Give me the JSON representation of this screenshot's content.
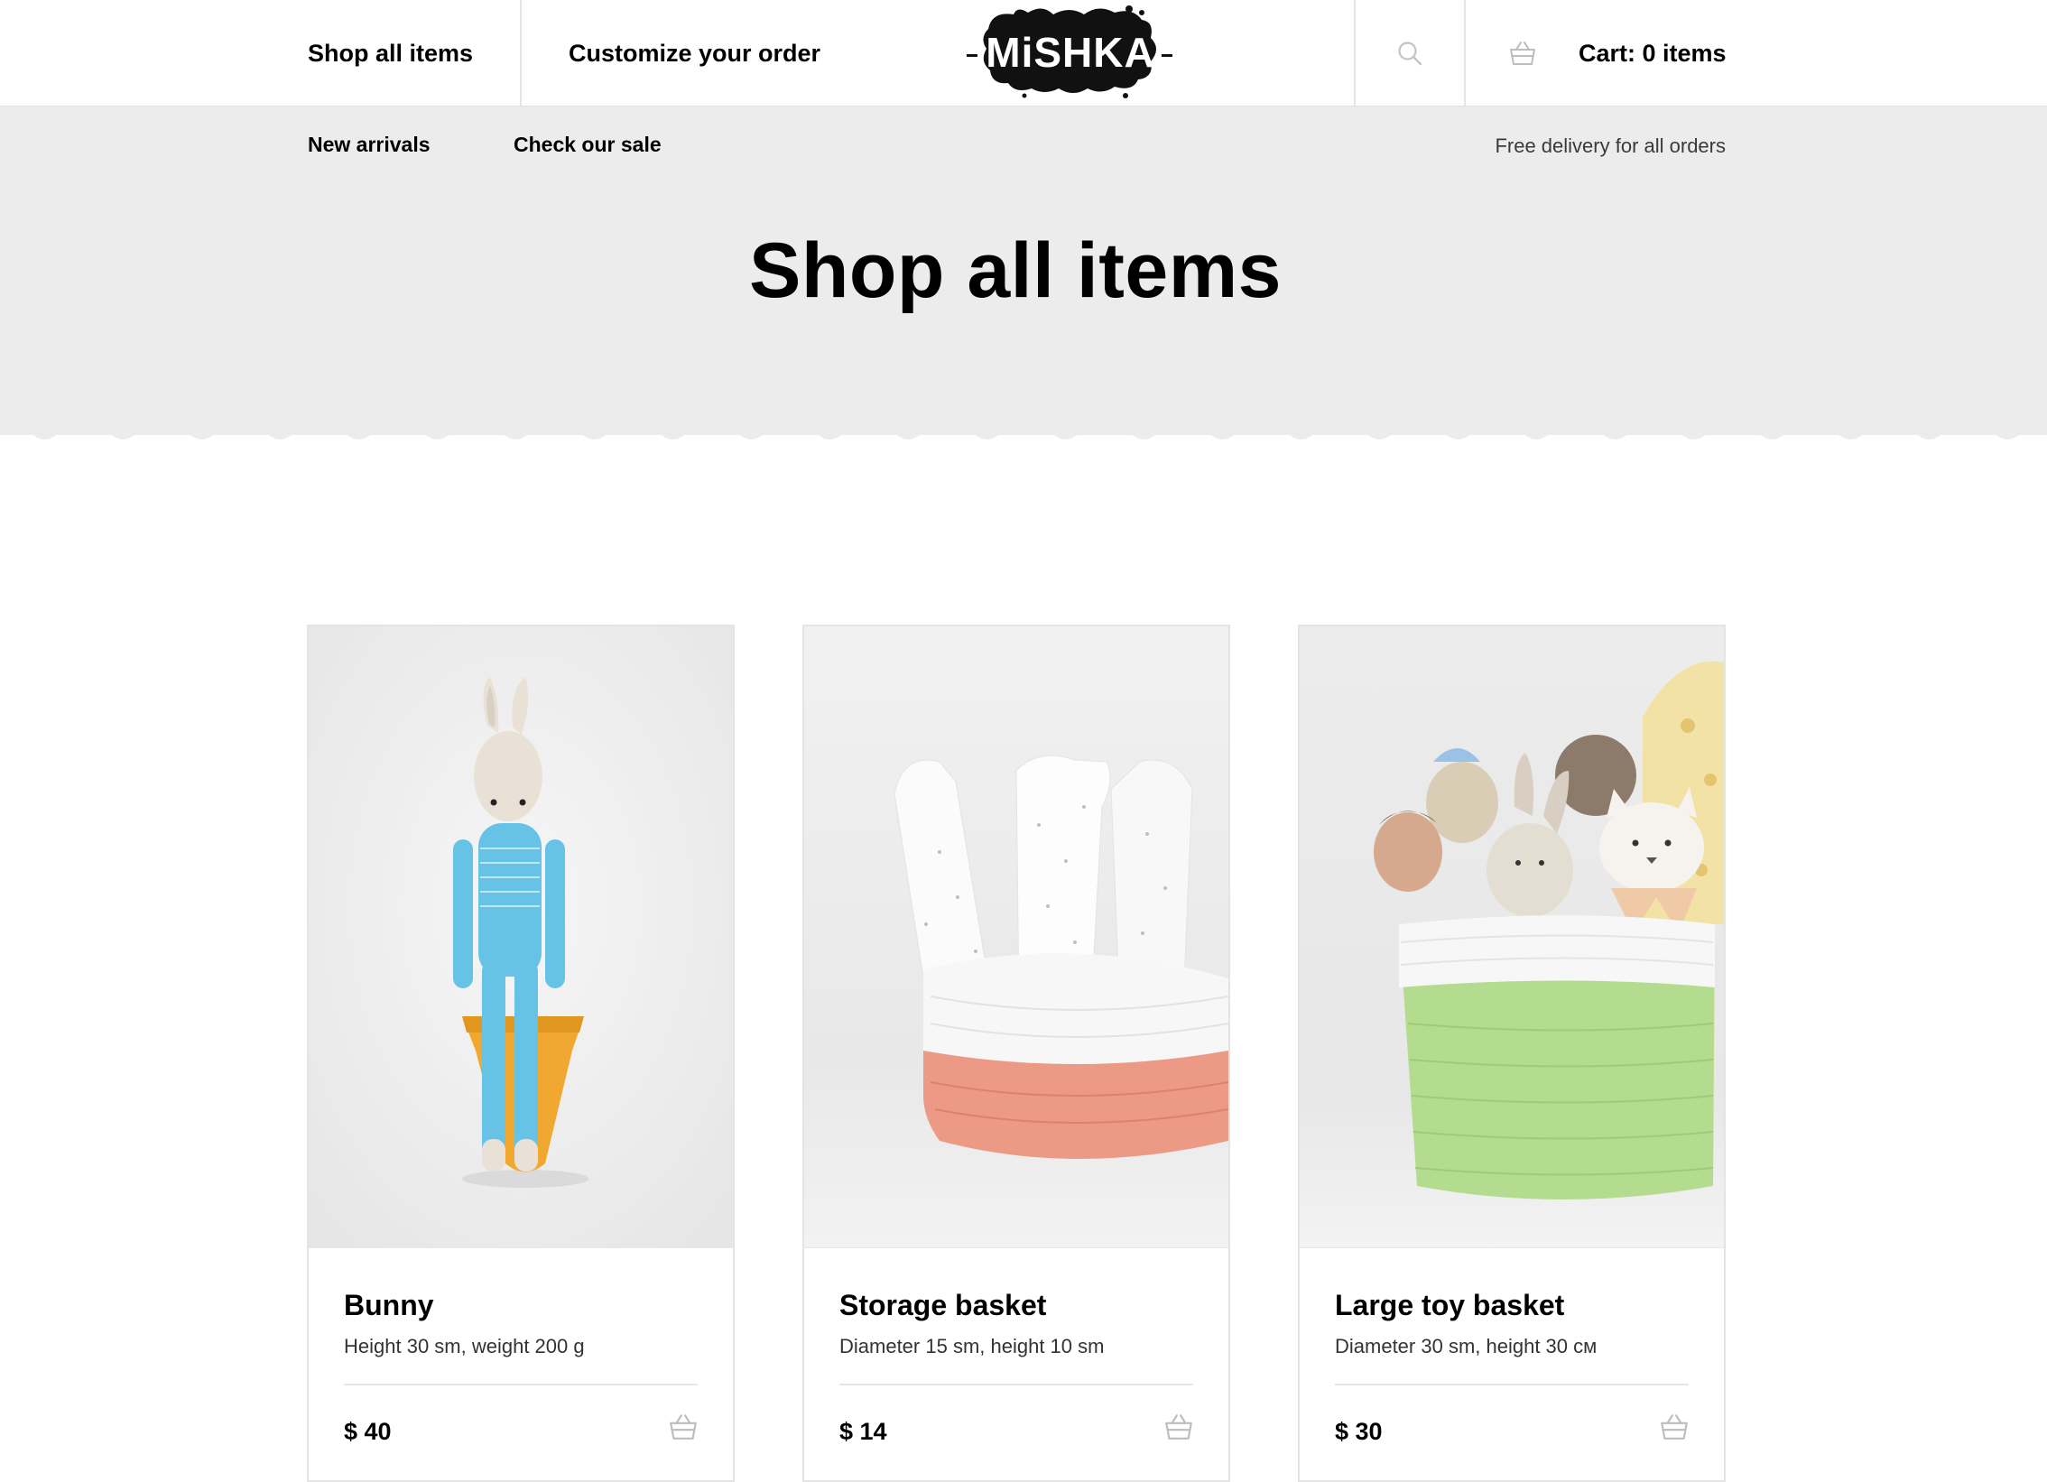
{
  "header": {
    "nav": {
      "shop_all": "Shop all items",
      "customize": "Customize your order"
    },
    "logo_text": "MiSHKA",
    "cart_label": "Cart: 0 items"
  },
  "band": {
    "subnav": {
      "new_arrivals": "New arrivals",
      "sale": "Check our sale"
    },
    "delivery_note": "Free delivery for all orders",
    "page_title": "Shop all items"
  },
  "products": [
    {
      "name": "Bunny",
      "desc": "Height 30 sm, weight 200 g",
      "price": "$ 40"
    },
    {
      "name": "Storage basket",
      "desc": "Diameter 15 sm, height 10 sm",
      "price": "$ 14"
    },
    {
      "name": "Large toy basket",
      "desc": "Diameter 30 sm, height 30 см",
      "price": "$ 30"
    }
  ],
  "colors": {
    "band": "#ececec",
    "bunny_blue": "#67c3e6",
    "cone_orange": "#f0a830",
    "basket_coral": "#ec9a86",
    "basket_green": "#b4dc8e"
  },
  "icons": [
    "search-icon",
    "basket-icon"
  ]
}
